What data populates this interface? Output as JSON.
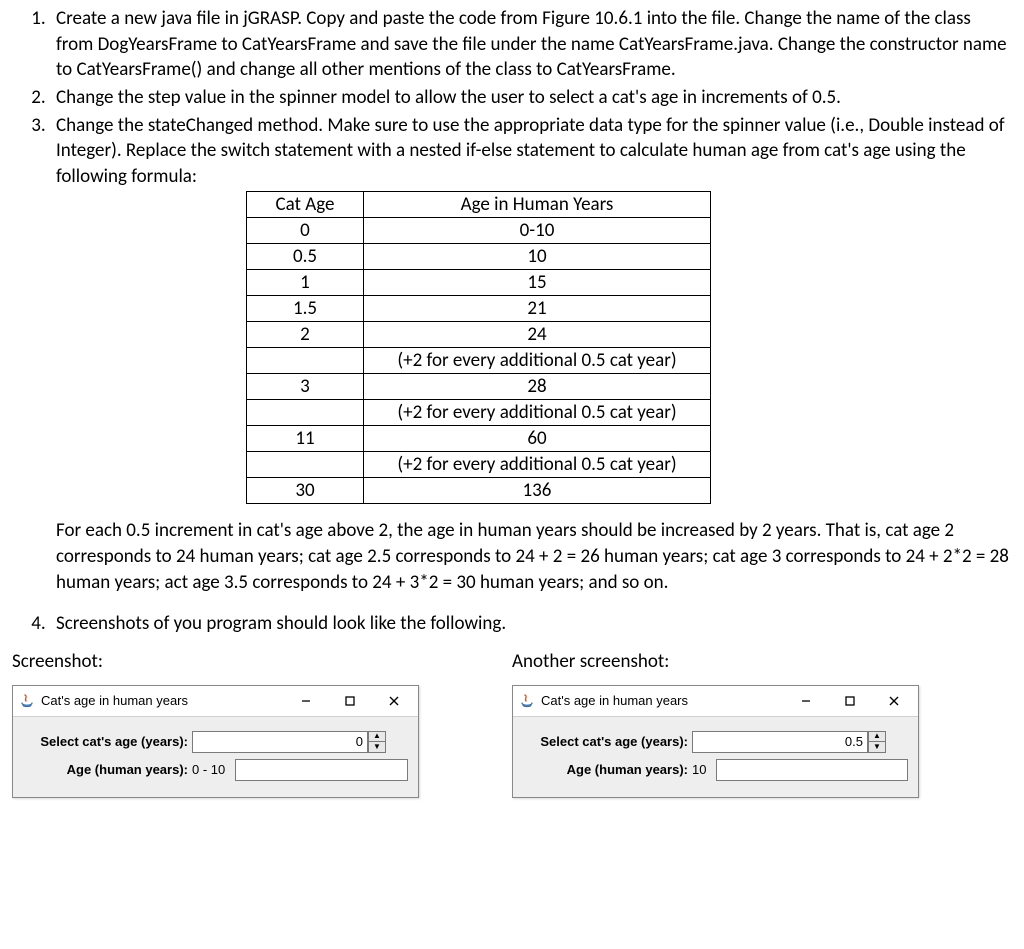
{
  "list": {
    "item1": "Create a new java file in jGRASP. Copy and paste the code from Figure 10.6.1 into the file. Change the name of the class from DogYearsFrame to CatYearsFrame and save the file under the name CatYearsFrame.java. Change the constructor name to CatYearsFrame() and change all other mentions of the class to CatYearsFrame.",
    "item2": "Change the step value in the spinner model to allow the user to select a cat's age in increments of 0.5.",
    "item3": "Change the stateChanged method. Make sure to use the appropriate data type for the spinner value (i.e., Double instead of Integer). Replace the switch statement with a nested if-else statement to calculate human age from cat's age using the following formula:",
    "item3_after": "For each 0.5 increment in cat's age above 2, the age in human years should be increased by 2 years. That is, cat age 2 corresponds to 24 human years; cat age 2.5 corresponds to 24 + 2 = 26 human years; cat age 3 corresponds to 24 + 2*2 = 28 human years; act age 3.5 corresponds to 24 + 3*2 = 30 human years; and so on.",
    "item4": "Screenshots of you program should look like the following."
  },
  "table": {
    "headers": {
      "col1": "Cat Age",
      "col2": "Age in Human Years"
    },
    "rows": [
      {
        "c1": "0",
        "c2": "0-10"
      },
      {
        "c1": "0.5",
        "c2": "10"
      },
      {
        "c1": "1",
        "c2": "15"
      },
      {
        "c1": "1.5",
        "c2": "21"
      },
      {
        "c1": "2",
        "c2": "24"
      },
      {
        "c1": "",
        "c2": "(+2 for every additional 0.5 cat year)"
      },
      {
        "c1": "3",
        "c2": "28"
      },
      {
        "c1": "",
        "c2": "(+2 for every additional 0.5 cat year)"
      },
      {
        "c1": "11",
        "c2": "60"
      },
      {
        "c1": "",
        "c2": "(+2 for every additional 0.5 cat year)"
      },
      {
        "c1": "30",
        "c2": "136"
      }
    ]
  },
  "screenshots": {
    "left_label": "Screenshot:",
    "right_label": "Another screenshot:",
    "window_title": "Cat's age in human years",
    "select_label": "Select cat's age (years):",
    "result_label": "Age (human years):",
    "left_spinner": "0",
    "left_result": "0 - 10",
    "right_spinner": "0.5",
    "right_result": "10"
  }
}
